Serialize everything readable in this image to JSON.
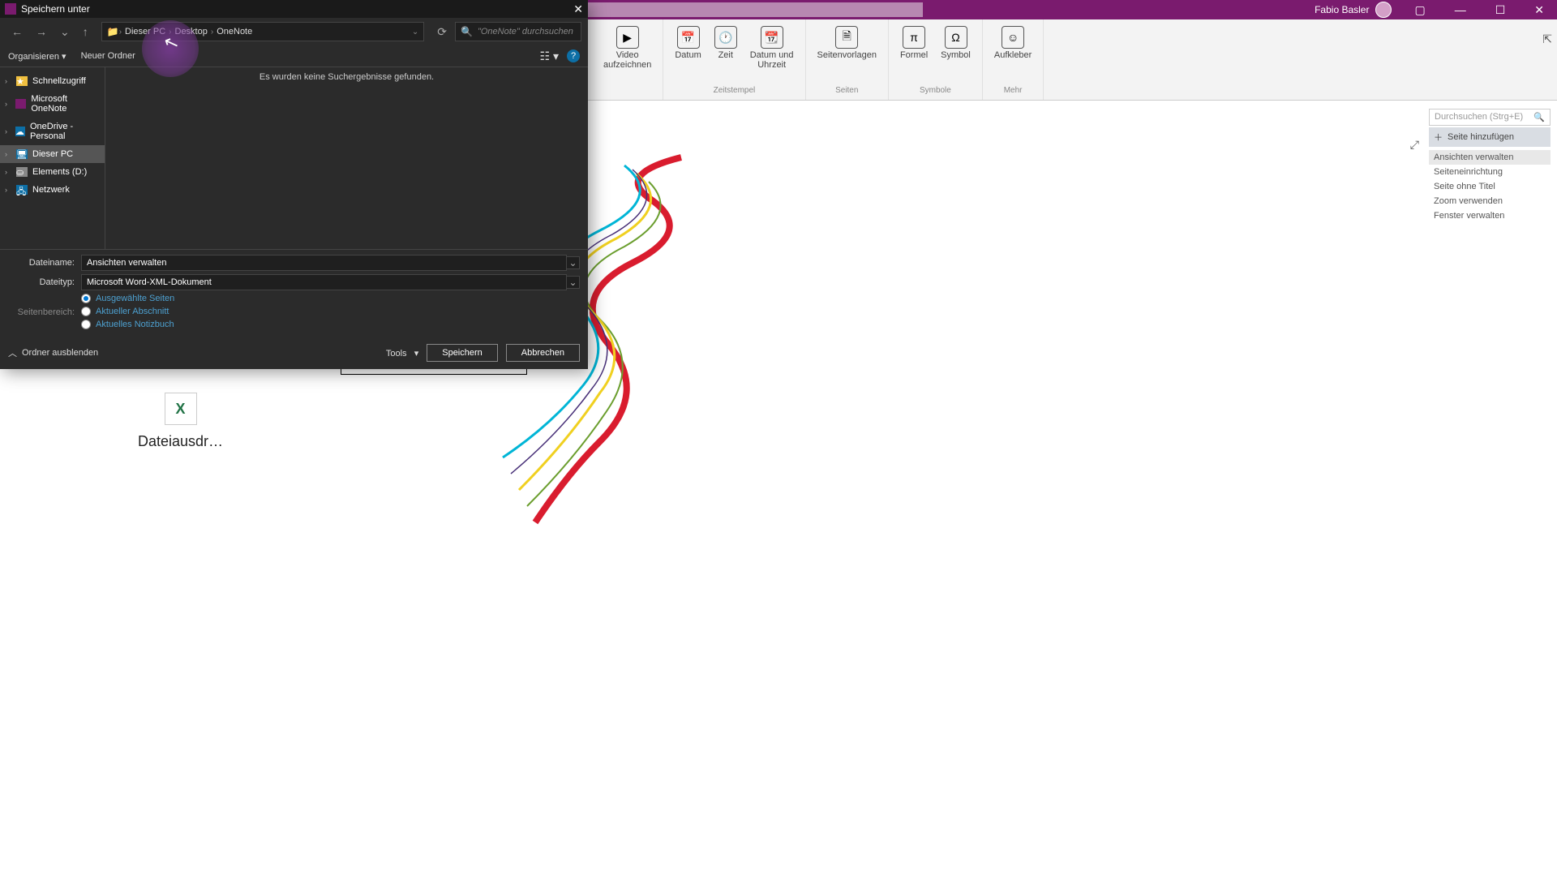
{
  "onenote": {
    "user": "Fabio Basler",
    "ribbon": {
      "groups": [
        {
          "label": "",
          "items": [
            {
              "label": "Video\naufzeichnen"
            }
          ]
        },
        {
          "label": "Zeitstempel",
          "items": [
            {
              "label": "Datum"
            },
            {
              "label": "Zeit"
            },
            {
              "label": "Datum und\nUhrzeit"
            }
          ]
        },
        {
          "label": "Seiten",
          "items": [
            {
              "label": "Seitenvorlagen"
            }
          ]
        },
        {
          "label": "Symbole",
          "items": [
            {
              "label": "Formel"
            },
            {
              "label": "Symbol"
            }
          ]
        },
        {
          "label": "Mehr",
          "items": [
            {
              "label": "Aufkleber"
            }
          ]
        }
      ]
    },
    "search_placeholder": "Durchsuchen (Strg+E)",
    "add_page": "Seite hinzufügen",
    "pages": [
      "Ansichten verwalten",
      "Seiteneinrichtung",
      "Seite ohne Titel",
      "Zoom verwenden",
      "Fenster verwalten"
    ],
    "excel_file": "Dateiausdr…"
  },
  "dialog": {
    "title": "Speichern unter",
    "breadcrumb": [
      "Dieser PC",
      "Desktop",
      "OneNote"
    ],
    "search_placeholder": "\"OneNote\" durchsuchen",
    "organize": "Organisieren",
    "new_folder": "Neuer Ordner",
    "tree": [
      {
        "label": "Schnellzugriff",
        "color": "#f0c040"
      },
      {
        "label": "Microsoft OneNote",
        "color": "#7a1b6e"
      },
      {
        "label": "OneDrive - Personal",
        "color": "#0d6fa6"
      },
      {
        "label": "Dieser PC",
        "color": "#0d6fa6",
        "selected": true
      },
      {
        "label": "Elements (D:)",
        "color": "#888"
      },
      {
        "label": "Netzwerk",
        "color": "#0d6fa6"
      }
    ],
    "empty": "Es wurden keine Suchergebnisse gefunden.",
    "filename_label": "Dateiname:",
    "filename_value": "Ansichten verwalten",
    "filetype_label": "Dateityp:",
    "filetype_value": "Microsoft Word-XML-Dokument",
    "range_label": "Seitenbereich:",
    "radios": [
      "Ausgewählte Seiten",
      "Aktueller Abschnitt",
      "Aktuelles Notizbuch"
    ],
    "hide_folders": "Ordner ausblenden",
    "tools": "Tools",
    "save": "Speichern",
    "cancel": "Abbrechen"
  }
}
